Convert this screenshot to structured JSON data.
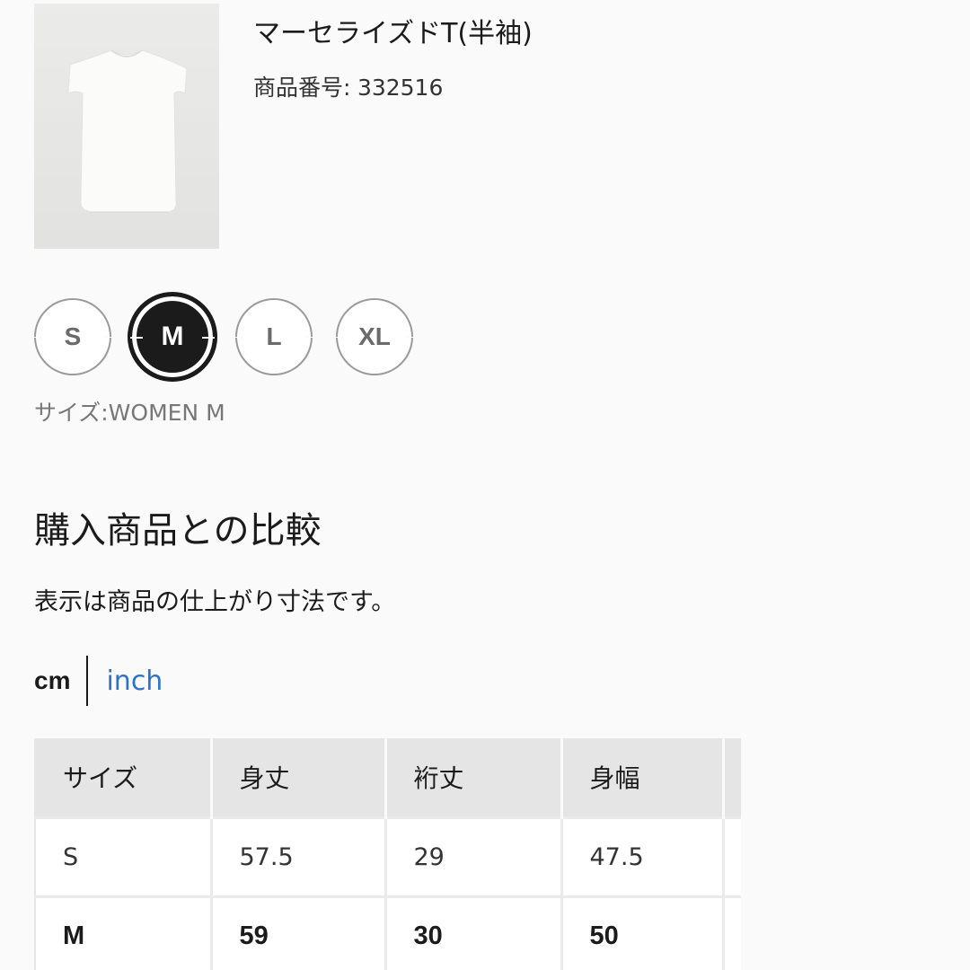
{
  "product": {
    "name": "マーセライズドT(半袖)",
    "number_label": "商品番号:",
    "number": "332516"
  },
  "sizes": {
    "options": [
      "S",
      "M",
      "L",
      "XL"
    ],
    "selected": "M",
    "caption": "サイズ:WOMEN M"
  },
  "comparison": {
    "title": "購入商品との比較",
    "note": "表示は商品の仕上がり寸法です。"
  },
  "units": {
    "active": "cm",
    "alternate": "inch",
    "active_color": "#1b1b1b",
    "link_color": "#2f73c8"
  },
  "table": {
    "headers": [
      "サイズ",
      "身丈",
      "裄丈",
      "身幅"
    ],
    "rows": [
      [
        "S",
        "57.5",
        "29",
        "47.5"
      ],
      [
        "M",
        "59",
        "30",
        "50"
      ]
    ],
    "highlighted_row": "M"
  },
  "icons": {
    "thumbnail": "white-tshirt-image"
  }
}
